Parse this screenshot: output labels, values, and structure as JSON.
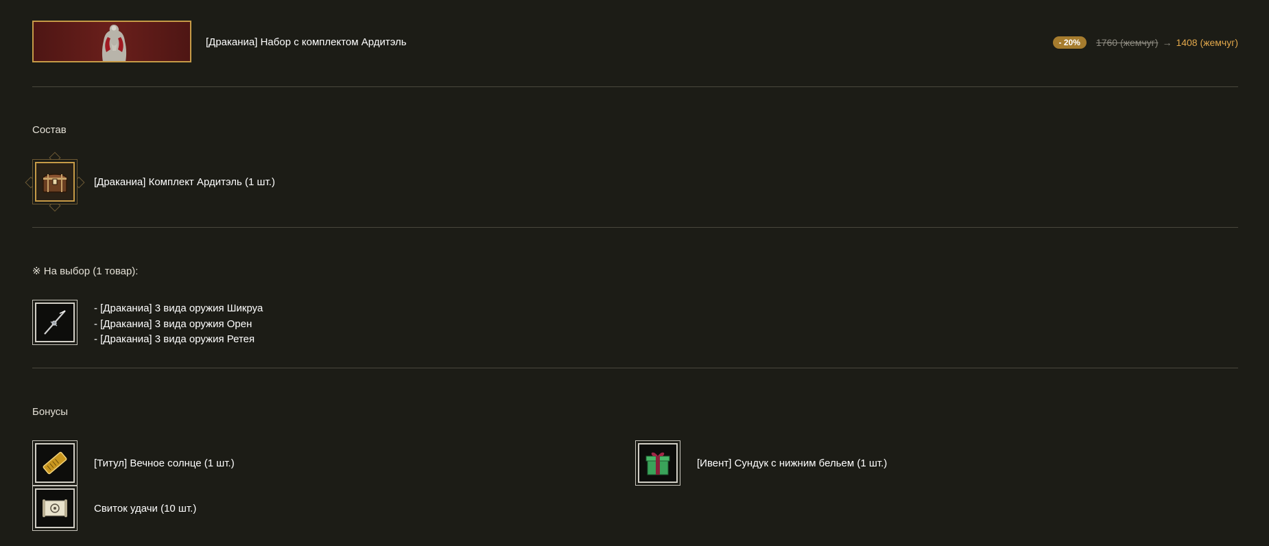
{
  "header": {
    "title": "[Драканиа] Набор с комплектом Ардитэль",
    "discount_badge": "- 20%",
    "old_price": "1760 (жемчуг)",
    "arrow": "→",
    "new_price": "1408 (жемчуг)"
  },
  "composition": {
    "label": "Состав",
    "item": {
      "icon": "chest-icon",
      "text": "[Драканиа] Комплект Ардитэль (1 шт.)"
    }
  },
  "choice": {
    "label": "※ На выбор (1 товар):",
    "icon": "weapon-icon",
    "options": [
      "- [Драканиа] 3 вида оружия Шикруа",
      "- [Драканиа] 3 вида оружия Орен",
      "- [Драканиа] 3 вида оружия Ретея"
    ]
  },
  "bonuses": {
    "label": "Бонусы",
    "items": [
      {
        "icon": "title-ticket-icon",
        "text": "[Титул] Вечное солнце (1 шт.)"
      },
      {
        "icon": "gift-box-icon",
        "text": "[Ивент] Сундук с нижним бельем (1 шт.)"
      },
      {
        "icon": "scroll-icon",
        "text": "Свиток удачи (10 шт.)"
      }
    ]
  },
  "colors": {
    "background": "#1c1c16",
    "accent_gold": "#c79b47",
    "discount_badge": "#a67c2e",
    "new_price": "#e2a84b",
    "divider": "#4a483e"
  }
}
